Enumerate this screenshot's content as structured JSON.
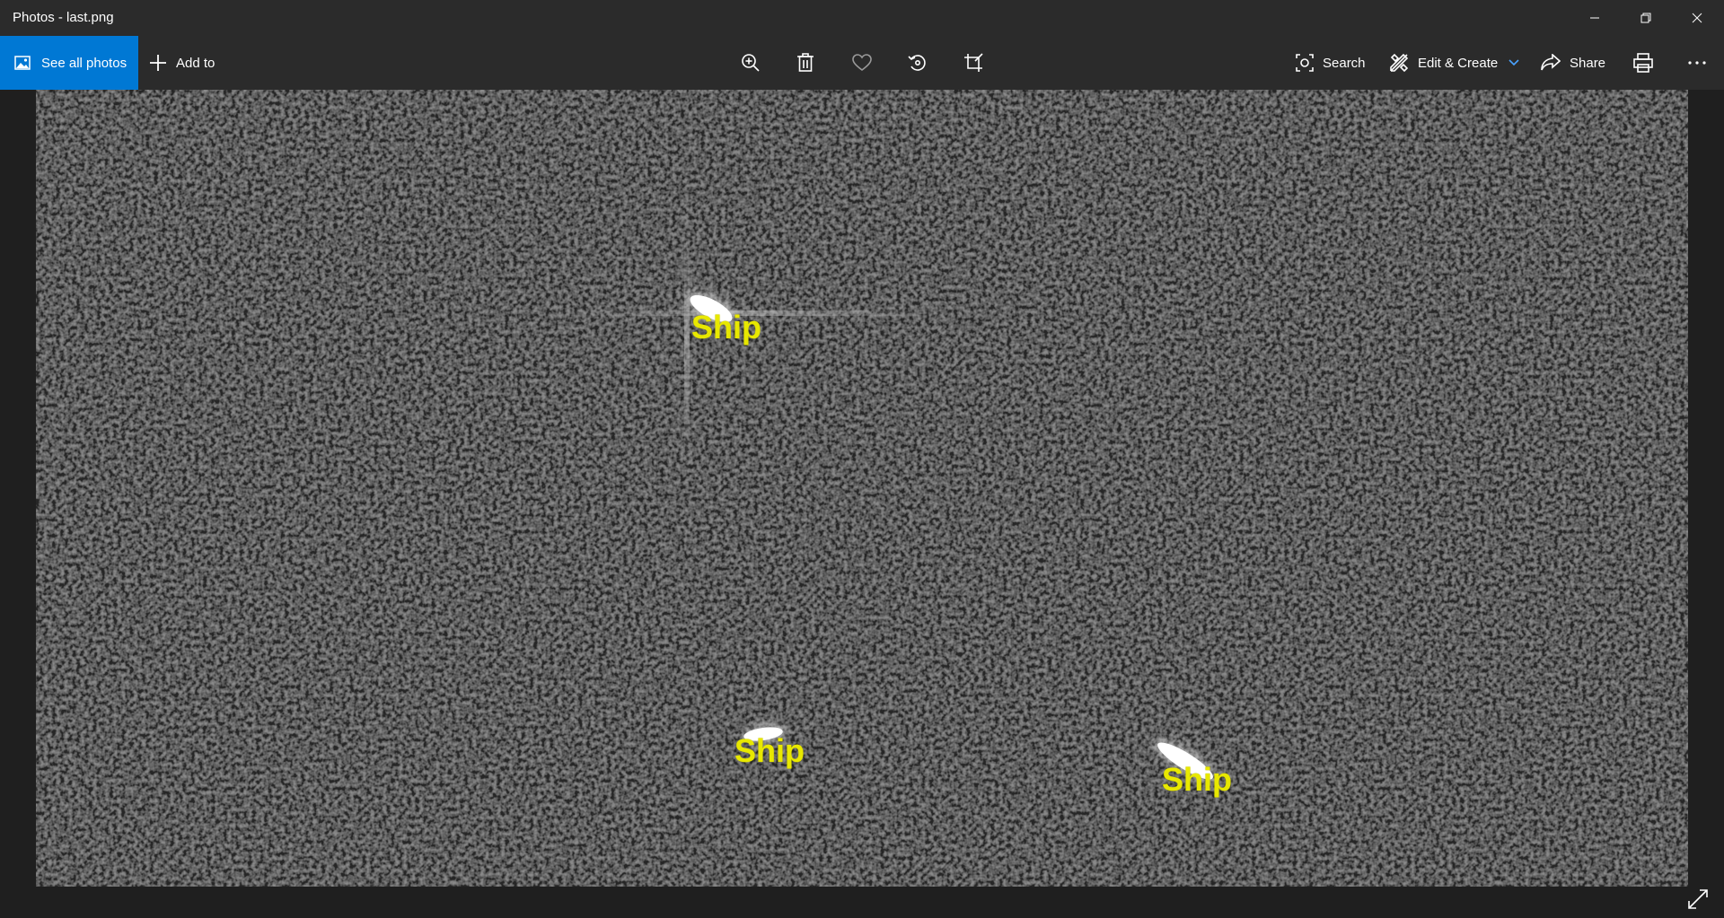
{
  "window": {
    "title": "Photos - last.png"
  },
  "toolbar": {
    "see_all_photos_label": "See all photos",
    "add_to_label": "Add to",
    "search_label": "Search",
    "edit_create_label": "Edit & Create",
    "share_label": "Share"
  },
  "icons": {
    "photos": "photos-icon",
    "add": "plus-icon",
    "zoom": "zoom-in-icon",
    "delete": "trash-icon",
    "favorite": "heart-icon",
    "rotate": "rotate-icon",
    "crop": "crop-icon",
    "search": "visual-search-icon",
    "edit": "edit-create-icon",
    "share": "share-icon",
    "print": "print-icon",
    "more": "more-icon",
    "expand": "expand-icon"
  },
  "colors": {
    "accent": "#0078d4",
    "label_yellow": "#e8e800",
    "chevron": "#4aa3ff"
  },
  "image": {
    "labels": [
      "Ship",
      "Ship",
      "Ship"
    ]
  }
}
